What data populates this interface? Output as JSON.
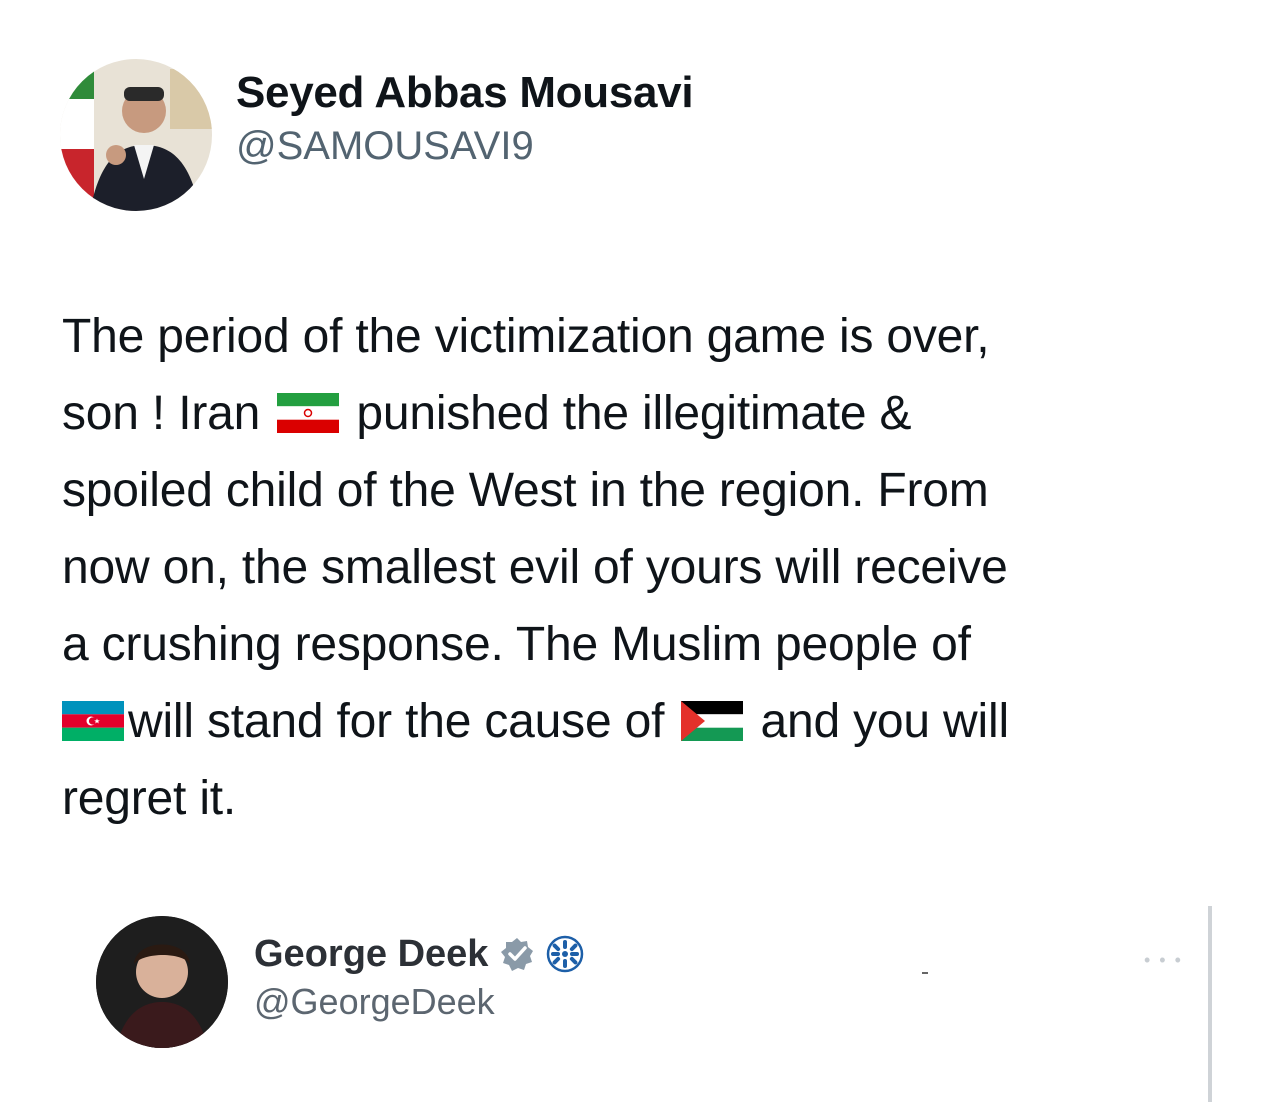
{
  "tweet": {
    "author": {
      "display_name": "Seyed Abbas Mousavi",
      "handle": "@SAMOUSAVI9",
      "avatar_icon": "profile-photo"
    },
    "text": {
      "line1": "The period of the victimization game is over,",
      "line2_a": "son ! Iran",
      "line2_b": "punished the illegitimate &",
      "line3": "spoiled child of the West in the region. From",
      "line4": "now on, the smallest evil of yours will receive",
      "line5": "a crushing response. The Muslim people of",
      "line6_a": "will stand for the cause of",
      "line6_b": "and you will",
      "line7": "regret it."
    },
    "flags": [
      "iran-flag",
      "azerbaijan-flag",
      "palestine-flag"
    ]
  },
  "quoted_tweet": {
    "display_name": "George Deek",
    "handle": "@GeorgeDeek",
    "badges": [
      "verified-badge-icon",
      "affiliate-badge-icon"
    ],
    "more_icon": "more-icon"
  }
}
